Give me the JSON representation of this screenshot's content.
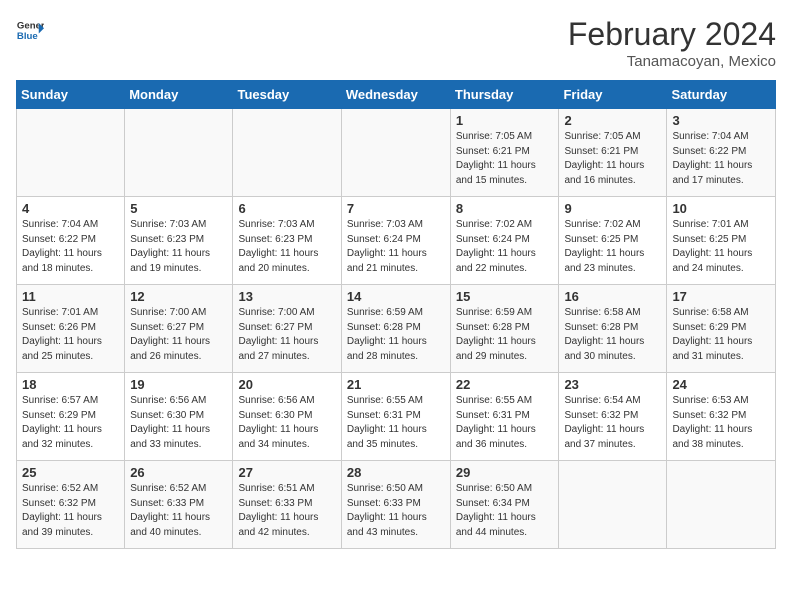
{
  "header": {
    "logo_line1": "General",
    "logo_line2": "Blue",
    "month_year": "February 2024",
    "location": "Tanamacoyan, Mexico"
  },
  "weekdays": [
    "Sunday",
    "Monday",
    "Tuesday",
    "Wednesday",
    "Thursday",
    "Friday",
    "Saturday"
  ],
  "weeks": [
    [
      {
        "day": "",
        "sunrise": "",
        "sunset": "",
        "daylight": ""
      },
      {
        "day": "",
        "sunrise": "",
        "sunset": "",
        "daylight": ""
      },
      {
        "day": "",
        "sunrise": "",
        "sunset": "",
        "daylight": ""
      },
      {
        "day": "",
        "sunrise": "",
        "sunset": "",
        "daylight": ""
      },
      {
        "day": "1",
        "sunrise": "7:05 AM",
        "sunset": "6:21 PM",
        "daylight": "11 hours and 15 minutes."
      },
      {
        "day": "2",
        "sunrise": "7:05 AM",
        "sunset": "6:21 PM",
        "daylight": "11 hours and 16 minutes."
      },
      {
        "day": "3",
        "sunrise": "7:04 AM",
        "sunset": "6:22 PM",
        "daylight": "11 hours and 17 minutes."
      }
    ],
    [
      {
        "day": "4",
        "sunrise": "7:04 AM",
        "sunset": "6:22 PM",
        "daylight": "11 hours and 18 minutes."
      },
      {
        "day": "5",
        "sunrise": "7:03 AM",
        "sunset": "6:23 PM",
        "daylight": "11 hours and 19 minutes."
      },
      {
        "day": "6",
        "sunrise": "7:03 AM",
        "sunset": "6:23 PM",
        "daylight": "11 hours and 20 minutes."
      },
      {
        "day": "7",
        "sunrise": "7:03 AM",
        "sunset": "6:24 PM",
        "daylight": "11 hours and 21 minutes."
      },
      {
        "day": "8",
        "sunrise": "7:02 AM",
        "sunset": "6:24 PM",
        "daylight": "11 hours and 22 minutes."
      },
      {
        "day": "9",
        "sunrise": "7:02 AM",
        "sunset": "6:25 PM",
        "daylight": "11 hours and 23 minutes."
      },
      {
        "day": "10",
        "sunrise": "7:01 AM",
        "sunset": "6:25 PM",
        "daylight": "11 hours and 24 minutes."
      }
    ],
    [
      {
        "day": "11",
        "sunrise": "7:01 AM",
        "sunset": "6:26 PM",
        "daylight": "11 hours and 25 minutes."
      },
      {
        "day": "12",
        "sunrise": "7:00 AM",
        "sunset": "6:27 PM",
        "daylight": "11 hours and 26 minutes."
      },
      {
        "day": "13",
        "sunrise": "7:00 AM",
        "sunset": "6:27 PM",
        "daylight": "11 hours and 27 minutes."
      },
      {
        "day": "14",
        "sunrise": "6:59 AM",
        "sunset": "6:28 PM",
        "daylight": "11 hours and 28 minutes."
      },
      {
        "day": "15",
        "sunrise": "6:59 AM",
        "sunset": "6:28 PM",
        "daylight": "11 hours and 29 minutes."
      },
      {
        "day": "16",
        "sunrise": "6:58 AM",
        "sunset": "6:28 PM",
        "daylight": "11 hours and 30 minutes."
      },
      {
        "day": "17",
        "sunrise": "6:58 AM",
        "sunset": "6:29 PM",
        "daylight": "11 hours and 31 minutes."
      }
    ],
    [
      {
        "day": "18",
        "sunrise": "6:57 AM",
        "sunset": "6:29 PM",
        "daylight": "11 hours and 32 minutes."
      },
      {
        "day": "19",
        "sunrise": "6:56 AM",
        "sunset": "6:30 PM",
        "daylight": "11 hours and 33 minutes."
      },
      {
        "day": "20",
        "sunrise": "6:56 AM",
        "sunset": "6:30 PM",
        "daylight": "11 hours and 34 minutes."
      },
      {
        "day": "21",
        "sunrise": "6:55 AM",
        "sunset": "6:31 PM",
        "daylight": "11 hours and 35 minutes."
      },
      {
        "day": "22",
        "sunrise": "6:55 AM",
        "sunset": "6:31 PM",
        "daylight": "11 hours and 36 minutes."
      },
      {
        "day": "23",
        "sunrise": "6:54 AM",
        "sunset": "6:32 PM",
        "daylight": "11 hours and 37 minutes."
      },
      {
        "day": "24",
        "sunrise": "6:53 AM",
        "sunset": "6:32 PM",
        "daylight": "11 hours and 38 minutes."
      }
    ],
    [
      {
        "day": "25",
        "sunrise": "6:52 AM",
        "sunset": "6:32 PM",
        "daylight": "11 hours and 39 minutes."
      },
      {
        "day": "26",
        "sunrise": "6:52 AM",
        "sunset": "6:33 PM",
        "daylight": "11 hours and 40 minutes."
      },
      {
        "day": "27",
        "sunrise": "6:51 AM",
        "sunset": "6:33 PM",
        "daylight": "11 hours and 42 minutes."
      },
      {
        "day": "28",
        "sunrise": "6:50 AM",
        "sunset": "6:33 PM",
        "daylight": "11 hours and 43 minutes."
      },
      {
        "day": "29",
        "sunrise": "6:50 AM",
        "sunset": "6:34 PM",
        "daylight": "11 hours and 44 minutes."
      },
      {
        "day": "",
        "sunrise": "",
        "sunset": "",
        "daylight": ""
      },
      {
        "day": "",
        "sunrise": "",
        "sunset": "",
        "daylight": ""
      }
    ]
  ]
}
